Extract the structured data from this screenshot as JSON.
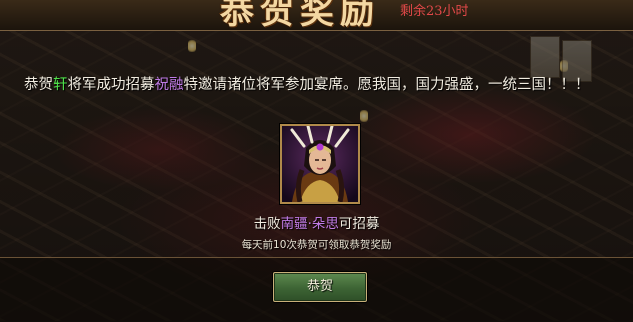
{
  "banner": {
    "title": "恭贺奖励",
    "remaining_time": "剩余23小时"
  },
  "message": {
    "part1": "恭贺",
    "player_name": "轩",
    "part2": "将军成功招募",
    "general_name": "祝融",
    "part3": "特邀请诸位将军参加宴席。愿我国，国力强盛，一统三国！！！"
  },
  "unlock": {
    "prefix": "击败",
    "target_a": "南疆",
    "separator": "·",
    "target_b": "朵思",
    "suffix": "可招募"
  },
  "reward_note": "每天前10次恭贺可领取恭贺奖励",
  "actions": {
    "congrats_label": "恭贺"
  },
  "colors": {
    "highlight_player": "#4fe04a",
    "highlight_general": "#c07be6",
    "remaining_time": "#e04848",
    "button": "#3d6434"
  }
}
